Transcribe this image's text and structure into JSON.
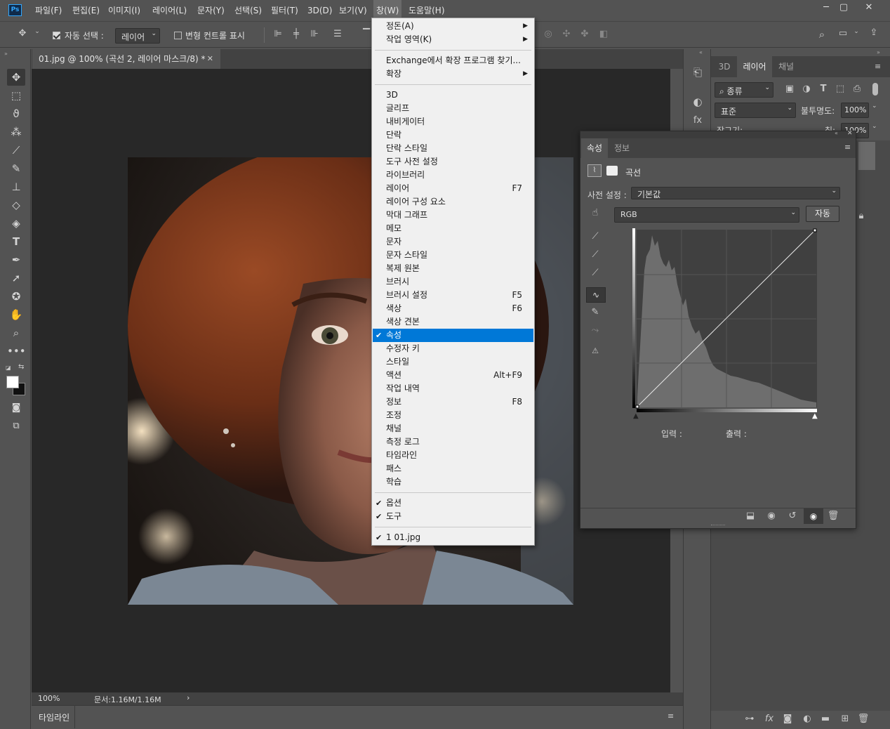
{
  "app": {
    "logo": "Ps"
  },
  "menubar": {
    "items": [
      "파일(F)",
      "편집(E)",
      "이미지(I)",
      "레이어(L)",
      "문자(Y)",
      "선택(S)",
      "필터(T)",
      "3D(D)",
      "보기(V)",
      "창(W)",
      "도움말(H)"
    ],
    "active": "창(W)",
    "window_controls": [
      "minimize-icon",
      "restore-icon",
      "close-icon"
    ]
  },
  "options": {
    "auto_select_label": "자동 선택 :",
    "auto_select_value": "레이어",
    "transform_controls_label": "변형 컨트롤 표시"
  },
  "document": {
    "tab_title": "01.jpg @ 100% (곡선 2, 레이어 마스크/8) *",
    "zoom": "100%",
    "doc_size": "문서:1.16M/1.16M",
    "timeline_label": "타임라인"
  },
  "layers_panel": {
    "tabs": [
      "3D",
      "레이어",
      "채널"
    ],
    "active_tab": "레이어",
    "filter_label": "종류",
    "blend_mode": "표준",
    "opacity_label": "불투명도:",
    "opacity_value": "100%",
    "lock_label": "잠그기:",
    "fill_label": "칠:",
    "fill_value": "100%"
  },
  "properties_panel": {
    "tabs": [
      "속성",
      "정보"
    ],
    "active_tab": "속성",
    "title": "곡선",
    "preset_label": "사전 설정 :",
    "preset_value": "기본값",
    "channel_value": "RGB",
    "auto_button": "자동",
    "input_label": "입력 :",
    "output_label": "출력 :"
  },
  "window_menu": {
    "items": [
      {
        "label": "정돈(A)",
        "submenu": true
      },
      {
        "label": "작업 영역(K)",
        "submenu": true
      },
      {
        "sep": true
      },
      {
        "label": "Exchange에서 확장 프로그램 찾기..."
      },
      {
        "label": "확장",
        "submenu": true
      },
      {
        "sep": true
      },
      {
        "label": "3D"
      },
      {
        "label": "글리프"
      },
      {
        "label": "내비게이터"
      },
      {
        "label": "단락"
      },
      {
        "label": "단락 스타일"
      },
      {
        "label": "도구 사전 설정"
      },
      {
        "label": "라이브러리"
      },
      {
        "label": "레이어",
        "shortcut": "F7"
      },
      {
        "label": "레이어 구성 요소"
      },
      {
        "label": "막대 그래프"
      },
      {
        "label": "메모"
      },
      {
        "label": "문자"
      },
      {
        "label": "문자 스타일"
      },
      {
        "label": "복제 원본"
      },
      {
        "label": "브러시"
      },
      {
        "label": "브러시 설정",
        "shortcut": "F5"
      },
      {
        "label": "색상",
        "shortcut": "F6"
      },
      {
        "label": "색상 견본"
      },
      {
        "label": "속성",
        "checked": true,
        "highlighted": true
      },
      {
        "label": "수정자 키"
      },
      {
        "label": "스타일"
      },
      {
        "label": "액션",
        "shortcut": "Alt+F9"
      },
      {
        "label": "작업 내역"
      },
      {
        "label": "정보",
        "shortcut": "F8"
      },
      {
        "label": "조정"
      },
      {
        "label": "채널"
      },
      {
        "label": "측정 로그"
      },
      {
        "label": "타임라인"
      },
      {
        "label": "패스"
      },
      {
        "label": "학습"
      },
      {
        "sep": true
      },
      {
        "label": "옵션",
        "checked": true
      },
      {
        "label": "도구",
        "checked": true
      },
      {
        "sep": true
      },
      {
        "label": "1 01.jpg",
        "checked": true
      }
    ]
  },
  "colors": {
    "accent": "#0078d7",
    "ui_bg": "#535353",
    "canvas_bg": "#282828"
  }
}
